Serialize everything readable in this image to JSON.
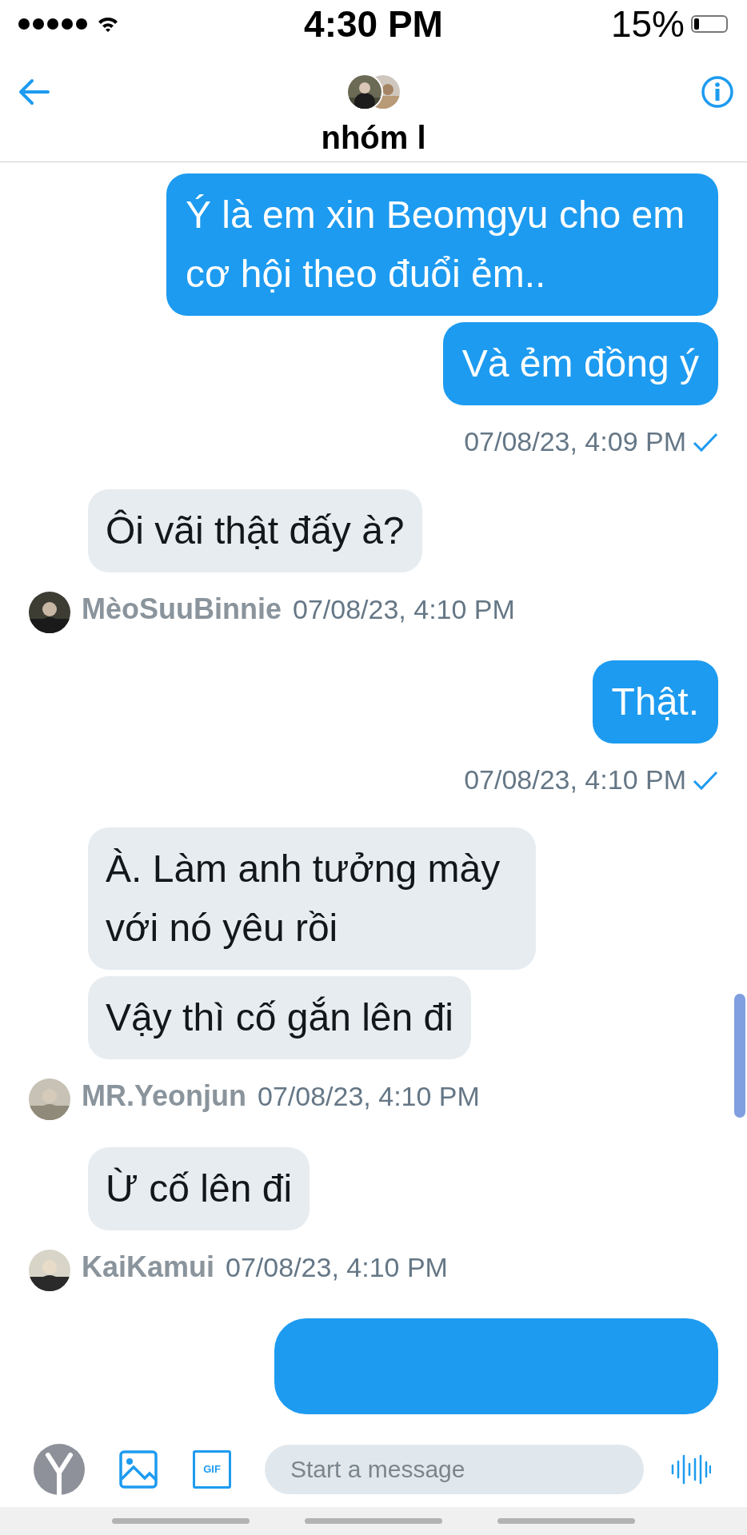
{
  "status_bar": {
    "time": "4:30 PM",
    "battery": "15%"
  },
  "header": {
    "title": "nhóm l"
  },
  "messages": [
    {
      "kind": "outgoing",
      "bubbles": [
        "Ý là em xin Beomgyu cho em cơ hội theo đuổi ẻm..",
        "Và ẻm đồng ý"
      ],
      "time": "07/08/23, 4:09 PM"
    },
    {
      "kind": "incoming",
      "bubbles": [
        "Ôi vãi thật đấy à?"
      ],
      "sender": "MèoSuuBinnie",
      "time": "07/08/23, 4:10 PM"
    },
    {
      "kind": "outgoing",
      "bubbles": [
        "Thật."
      ],
      "time": "07/08/23, 4:10 PM"
    },
    {
      "kind": "incoming",
      "bubbles": [
        "À. Làm anh tưởng mày với nó yêu rồi",
        "Vậy thì cố gắn lên đi"
      ],
      "sender": "MR.Yeonjun",
      "time": "07/08/23, 4:10 PM"
    },
    {
      "kind": "incoming",
      "bubbles": [
        "Ừ cố lên đi"
      ],
      "sender": "KaiKamui",
      "time": "07/08/23, 4:10 PM"
    }
  ],
  "composer": {
    "gif_label": "GIF",
    "placeholder": "Start a message"
  }
}
